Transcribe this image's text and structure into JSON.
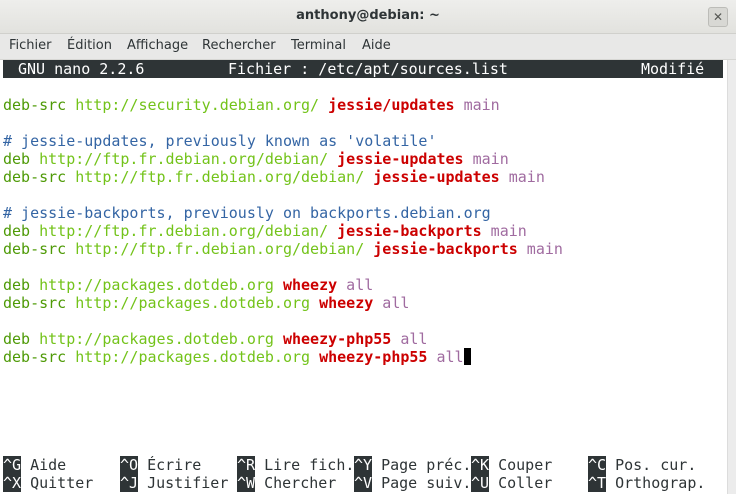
{
  "window": {
    "title": "anthony@debian: ~",
    "close_symbol": "✕"
  },
  "menu": [
    "Fichier",
    "Édition",
    "Affichage",
    "Rechercher",
    "Terminal",
    "Aide"
  ],
  "nano": {
    "version": "GNU nano 2.2.6",
    "file": "Fichier : /etc/apt/sources.list",
    "status": "Modifié"
  },
  "lines": [
    [
      {
        "t": "deb-src ",
        "c": "deb"
      },
      {
        "t": "http://security.debian.org/ ",
        "c": "url"
      },
      {
        "t": "jessie/updates",
        "c": "dist"
      },
      {
        "t": " main",
        "c": "comp"
      }
    ],
    [],
    [
      {
        "t": "# jessie-updates, previously known as 'volatile'",
        "c": "comment"
      }
    ],
    [
      {
        "t": "deb ",
        "c": "deb"
      },
      {
        "t": "http://ftp.fr.debian.org/debian/ ",
        "c": "url"
      },
      {
        "t": "jessie-updates",
        "c": "dist"
      },
      {
        "t": " main",
        "c": "comp"
      }
    ],
    [
      {
        "t": "deb-src ",
        "c": "deb"
      },
      {
        "t": "http://ftp.fr.debian.org/debian/ ",
        "c": "url"
      },
      {
        "t": "jessie-updates",
        "c": "dist"
      },
      {
        "t": " main",
        "c": "comp"
      }
    ],
    [],
    [
      {
        "t": "# jessie-backports, previously on backports.debian.org",
        "c": "comment"
      }
    ],
    [
      {
        "t": "deb ",
        "c": "deb"
      },
      {
        "t": "http://ftp.fr.debian.org/debian/ ",
        "c": "url"
      },
      {
        "t": "jessie-backports",
        "c": "dist"
      },
      {
        "t": " main",
        "c": "comp"
      }
    ],
    [
      {
        "t": "deb-src ",
        "c": "deb"
      },
      {
        "t": "http://ftp.fr.debian.org/debian/ ",
        "c": "url"
      },
      {
        "t": "jessie-backports",
        "c": "dist"
      },
      {
        "t": " main",
        "c": "comp"
      }
    ],
    [],
    [
      {
        "t": "deb ",
        "c": "deb"
      },
      {
        "t": "http://packages.dotdeb.org ",
        "c": "url"
      },
      {
        "t": "wheezy",
        "c": "dist"
      },
      {
        "t": " all",
        "c": "comp"
      }
    ],
    [
      {
        "t": "deb-src ",
        "c": "deb"
      },
      {
        "t": "http://packages.dotdeb.org ",
        "c": "url"
      },
      {
        "t": "wheezy",
        "c": "dist"
      },
      {
        "t": " all",
        "c": "comp"
      }
    ],
    [],
    [
      {
        "t": "deb ",
        "c": "deb"
      },
      {
        "t": "http://packages.dotdeb.org ",
        "c": "url"
      },
      {
        "t": "wheezy-php55",
        "c": "dist"
      },
      {
        "t": " all",
        "c": "comp"
      }
    ],
    [
      {
        "t": "deb-src ",
        "c": "deb"
      },
      {
        "t": "http://packages.dotdeb.org ",
        "c": "url"
      },
      {
        "t": "wheezy-php55",
        "c": "dist"
      },
      {
        "t": " all",
        "c": "comp"
      }
    ]
  ],
  "shortcuts": [
    [
      {
        "key": "^G",
        "label": "Aide"
      },
      {
        "key": "^O",
        "label": "Écrire"
      },
      {
        "key": "^R",
        "label": "Lire fich."
      },
      {
        "key": "^Y",
        "label": "Page préc."
      },
      {
        "key": "^K",
        "label": "Couper"
      },
      {
        "key": "^C",
        "label": "Pos. cur."
      }
    ],
    [
      {
        "key": "^X",
        "label": "Quitter"
      },
      {
        "key": "^J",
        "label": "Justifier"
      },
      {
        "key": "^W",
        "label": "Chercher"
      },
      {
        "key": "^V",
        "label": "Page suiv."
      },
      {
        "key": "^U",
        "label": "Coller"
      },
      {
        "key": "^T",
        "label": "Orthograp."
      }
    ]
  ]
}
